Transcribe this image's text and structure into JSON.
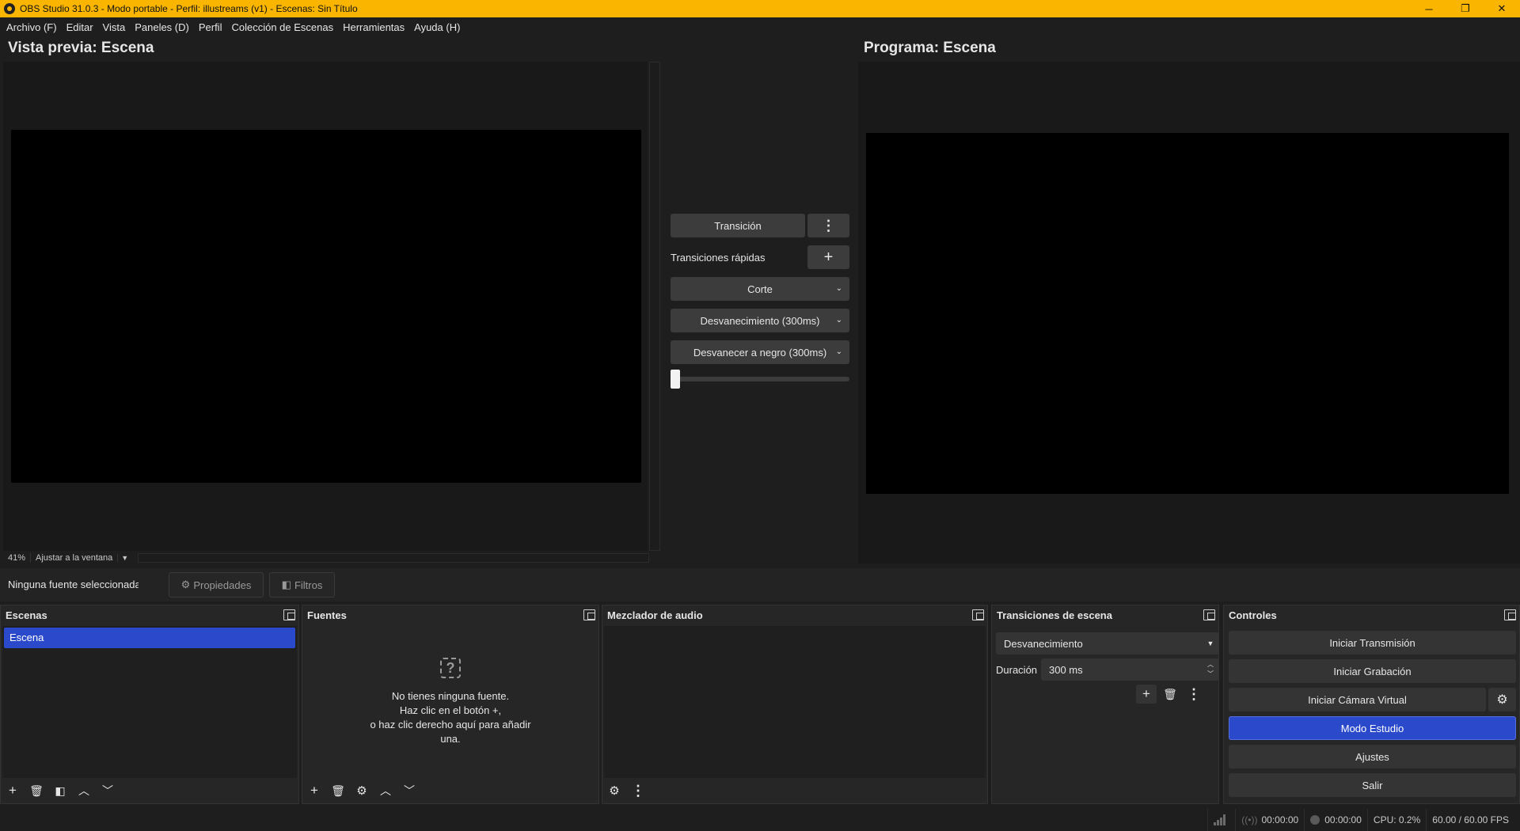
{
  "window": {
    "title": "OBS Studio 31.0.3 - Modo portable - Perfil: illustreams (v1) - Escenas: Sin Título",
    "minimize_glyph": "─",
    "restore_glyph": "❐",
    "close_glyph": "✕"
  },
  "menu": [
    "Archivo (F)",
    "Editar",
    "Vista",
    "Paneles (D)",
    "Perfil",
    "Colección de Escenas",
    "Herramientas",
    "Ayuda (H)"
  ],
  "preview": {
    "title": "Vista previa: Escena",
    "zoom": "41%",
    "scale_mode": "Ajustar a la ventana"
  },
  "program": {
    "title": "Programa: Escena"
  },
  "transition_panel": {
    "transition_button": "Transición",
    "quick_label": "Transiciones rápidas",
    "quick_items": [
      "Corte",
      "Desvanecimiento (300ms)",
      "Desvanecer a negro (300ms)"
    ],
    "tbar_value": 0
  },
  "source_toolbar": {
    "no_source": "Ninguna fuente seleccionada",
    "properties": "Propiedades",
    "filters": "Filtros"
  },
  "docks": {
    "scenes": {
      "title": "Escenas",
      "items": [
        "Escena"
      ]
    },
    "sources": {
      "title": "Fuentes",
      "empty_line1": "No tienes ninguna fuente.",
      "empty_line2": "Haz clic en el botón +,",
      "empty_line3": "o haz clic derecho aquí para añadir",
      "empty_line4": "una."
    },
    "mixer": {
      "title": "Mezclador de audio"
    },
    "transitions": {
      "title": "Transiciones de escena",
      "selected": "Desvanecimiento",
      "duration_label": "Duración",
      "duration_value": "300 ms"
    },
    "controls": {
      "title": "Controles",
      "start_stream": "Iniciar Transmisión",
      "start_record": "Iniciar Grabación",
      "start_virtualcam": "Iniciar Cámara Virtual",
      "studio_mode": "Modo Estudio",
      "settings": "Ajustes",
      "exit": "Salir"
    }
  },
  "status": {
    "stream_time": "00:00:00",
    "record_time": "00:00:00",
    "cpu": "CPU: 0.2%",
    "fps": "60.00 / 60.00 FPS"
  },
  "colors": {
    "title_bar": "#f9b500",
    "accent": "#2a4acb",
    "background": "#1e1e1e"
  }
}
